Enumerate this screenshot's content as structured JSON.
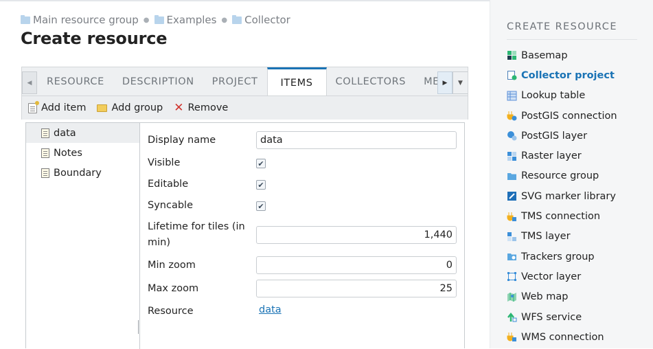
{
  "breadcrumb": [
    {
      "label": "Main resource group"
    },
    {
      "label": "Examples"
    },
    {
      "label": "Collector"
    }
  ],
  "page_title": "Create resource",
  "tabs": [
    {
      "label": "RESOURCE",
      "active": false
    },
    {
      "label": "DESCRIPTION",
      "active": false
    },
    {
      "label": "PROJECT",
      "active": false
    },
    {
      "label": "ITEMS",
      "active": true
    },
    {
      "label": "COLLECTORS",
      "active": false
    },
    {
      "label": "MET",
      "active": false
    }
  ],
  "toolbar": {
    "add_item": "Add item",
    "add_group": "Add group",
    "remove": "Remove"
  },
  "tree": [
    {
      "label": "data",
      "selected": true
    },
    {
      "label": "Notes",
      "selected": false
    },
    {
      "label": "Boundary",
      "selected": false
    }
  ],
  "form": {
    "display_name_label": "Display name",
    "display_name_value": "data",
    "visible_label": "Visible",
    "visible_checked": true,
    "editable_label": "Editable",
    "editable_checked": true,
    "syncable_label": "Syncable",
    "syncable_checked": true,
    "lifetime_label_line1": "Lifetime for tiles (in",
    "lifetime_label_line2": "min)",
    "lifetime_value": "1,440",
    "min_zoom_label": "Min zoom",
    "min_zoom_value": "0",
    "max_zoom_label": "Max zoom",
    "max_zoom_value": "25",
    "resource_label": "Resource",
    "resource_link": "data"
  },
  "sidebar": {
    "title": "CREATE RESOURCE",
    "items": [
      {
        "label": "Basemap",
        "icon": "basemap-icon",
        "color": "#2bb673",
        "active": false
      },
      {
        "label": "Collector project",
        "icon": "collector-project-icon",
        "color": "#2bb673",
        "active": true
      },
      {
        "label": "Lookup table",
        "icon": "lookup-table-icon",
        "color": "#5b8fd8",
        "active": false
      },
      {
        "label": "PostGIS connection",
        "icon": "postgis-connection-icon",
        "color": "#f2b01e",
        "active": false
      },
      {
        "label": "PostGIS layer",
        "icon": "postgis-layer-icon",
        "color": "#3b8fd9",
        "active": false
      },
      {
        "label": "Raster layer",
        "icon": "raster-layer-icon",
        "color": "#3b8fd9",
        "active": false
      },
      {
        "label": "Resource group",
        "icon": "resource-group-icon",
        "color": "#5aa7e0",
        "active": false
      },
      {
        "label": "SVG marker library",
        "icon": "svg-marker-library-icon",
        "color": "#1e6fb8",
        "active": false
      },
      {
        "label": "TMS connection",
        "icon": "tms-connection-icon",
        "color": "#f2b01e",
        "active": false
      },
      {
        "label": "TMS layer",
        "icon": "tms-layer-icon",
        "color": "#3b8fd9",
        "active": false
      },
      {
        "label": "Trackers group",
        "icon": "trackers-group-icon",
        "color": "#5aa7e0",
        "active": false
      },
      {
        "label": "Vector layer",
        "icon": "vector-layer-icon",
        "color": "#3b8fd9",
        "active": false
      },
      {
        "label": "Web map",
        "icon": "web-map-icon",
        "color": "#2bb673",
        "active": false
      },
      {
        "label": "WFS service",
        "icon": "wfs-service-icon",
        "color": "#2bb673",
        "active": false
      },
      {
        "label": "WMS connection",
        "icon": "wms-connection-icon",
        "color": "#f2b01e",
        "active": false
      }
    ]
  }
}
